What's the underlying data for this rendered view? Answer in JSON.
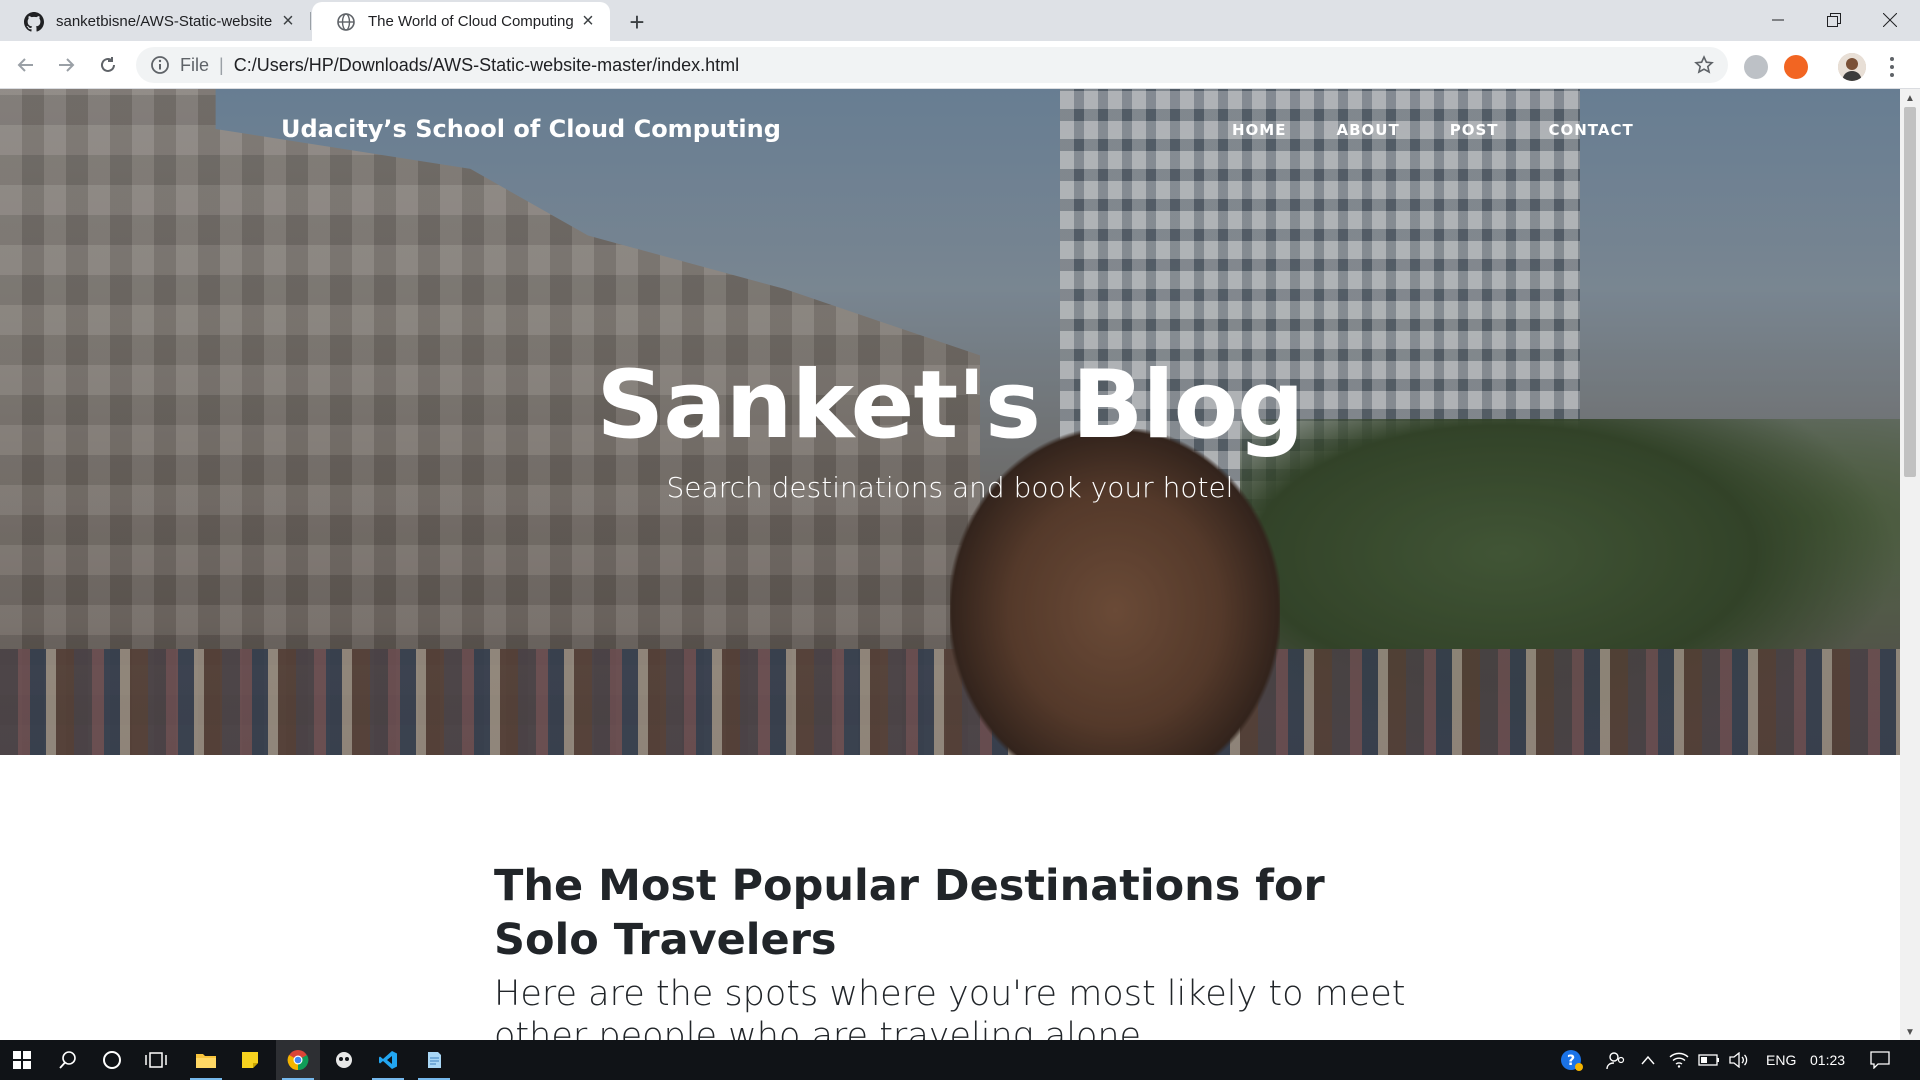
{
  "browser": {
    "tabs": [
      {
        "title": "sanketbisne/AWS-Static-website",
        "icon": "github-icon",
        "active": false
      },
      {
        "title": "The World of Cloud Computing",
        "icon": "globe-icon",
        "active": true
      }
    ],
    "address": {
      "scheme_label": "File",
      "url": "C:/Users/HP/Downloads/AWS-Static-website-master/index.html"
    }
  },
  "site": {
    "brand": "Udacity’s School of Cloud Computing",
    "nav": [
      "HOME",
      "ABOUT",
      "POST",
      "CONTACT"
    ],
    "hero": {
      "title": "Sanket's Blog",
      "subtitle": "Search destinations and book your hotel"
    },
    "post": {
      "title": "The Most Popular Destinations for Solo Travelers",
      "subtitle": "Here are the spots where you're most likely to meet other people who are traveling alone"
    }
  },
  "taskbar": {
    "language": "ENG",
    "time": "01:23"
  },
  "colors": {
    "chrome_tabstrip": "#dee1e6",
    "taskbar": "#101317",
    "text_dark": "#212529"
  }
}
